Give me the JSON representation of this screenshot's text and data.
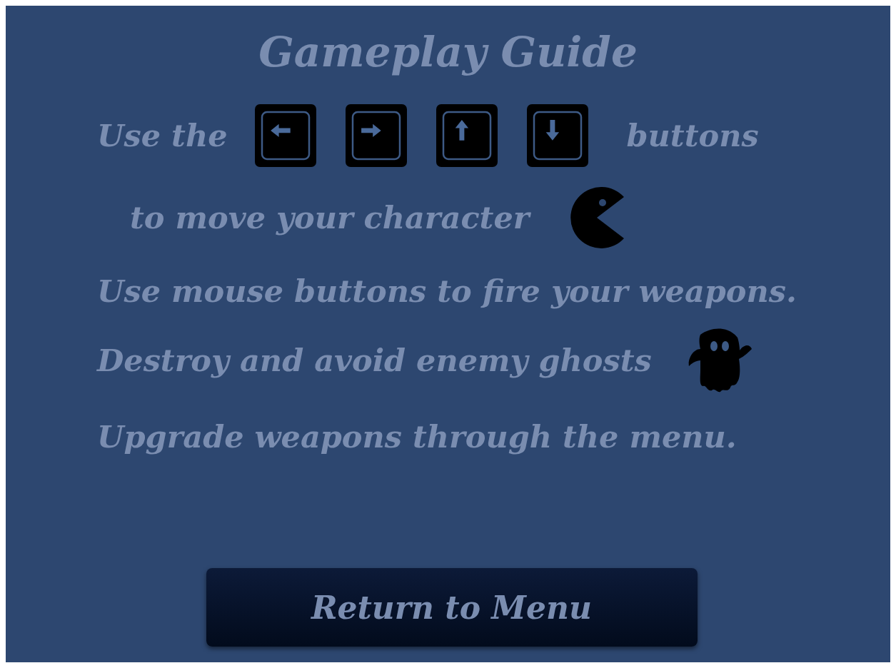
{
  "title": "Gameplay Guide",
  "lines": [
    {
      "kind": "keys",
      "before": "Use the",
      "after": "buttons"
    },
    {
      "kind": "player",
      "text": "to move your character"
    },
    {
      "kind": "text",
      "text": "Use mouse buttons to fire your weapons."
    },
    {
      "kind": "enemy",
      "text": "Destroy and avoid enemy ghosts"
    },
    {
      "kind": "text",
      "text": "Upgrade weapons through the menu."
    }
  ],
  "button": "Return to Menu"
}
